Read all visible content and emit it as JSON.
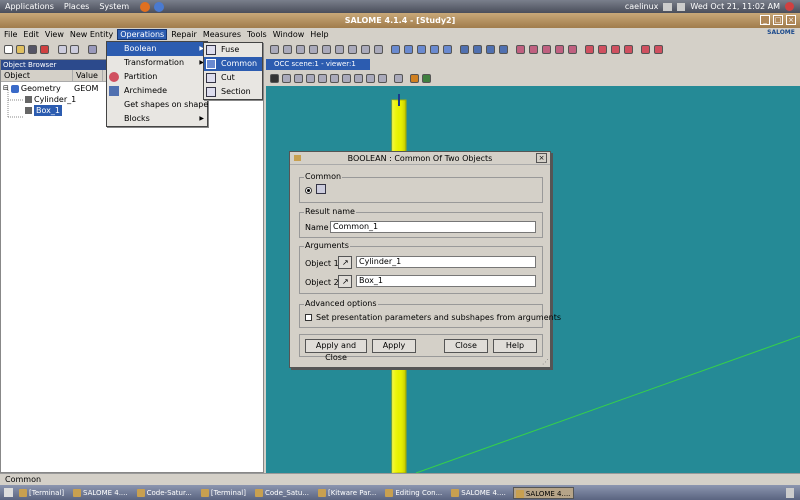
{
  "top_panel": {
    "menus": [
      "Applications",
      "Places",
      "System"
    ],
    "user": "caelinux",
    "datetime": "Wed Oct 21, 11:02 AM"
  },
  "window": {
    "title": "SALOME 4.1.4 - [Study2]"
  },
  "menubar": [
    "File",
    "Edit",
    "View",
    "New Entity",
    "Operations",
    "Repair",
    "Measures",
    "Tools",
    "Window",
    "Help"
  ],
  "menubar_active": "Operations",
  "brand": "SALOME",
  "object_browser": {
    "header": "Object Browser",
    "col_object": "Object",
    "col_value": "Value",
    "items": [
      {
        "label": "Geometry",
        "value": "GEOM"
      },
      {
        "label": "Cylinder_1",
        "value": ""
      },
      {
        "label": "Box_1",
        "value": ""
      }
    ]
  },
  "viewer_tab": "OCC scene:1 - viewer:1",
  "operations_menu": [
    "Boolean",
    "Transformation",
    "Partition",
    "Archimede",
    "Get shapes on shape",
    "Blocks"
  ],
  "boolean_menu": [
    "Fuse",
    "Common",
    "Cut",
    "Section"
  ],
  "dialog": {
    "title": "BOOLEAN : Common Of Two Objects",
    "group_common": "Common",
    "group_result": "Result name",
    "name_label": "Name",
    "name_value": "Common_1",
    "group_arguments": "Arguments",
    "object1_label": "Object 1",
    "object1_value": "Cylinder_1",
    "object2_label": "Object 2",
    "object2_value": "Box_1",
    "group_advanced": "Advanced options",
    "checkbox_label": "Set presentation parameters and subshapes from arguments",
    "buttons": {
      "apply_close": "Apply and Close",
      "apply": "Apply",
      "close": "Close",
      "help": "Help"
    }
  },
  "status": "Common",
  "taskbar": [
    "[Terminal]",
    "SALOME 4....",
    "Code-Satur...",
    "[Terminal]",
    "Code_Satu...",
    "[Kitware Par...",
    "Editing Con...",
    "SALOME 4....",
    "SALOME 4...."
  ],
  "taskbar_active": 7,
  "colors": {
    "viewer_bg": "#258a96",
    "selection": "#2c5cb0",
    "cylinder": "#e8f000",
    "axis_line": "#36d04a"
  }
}
